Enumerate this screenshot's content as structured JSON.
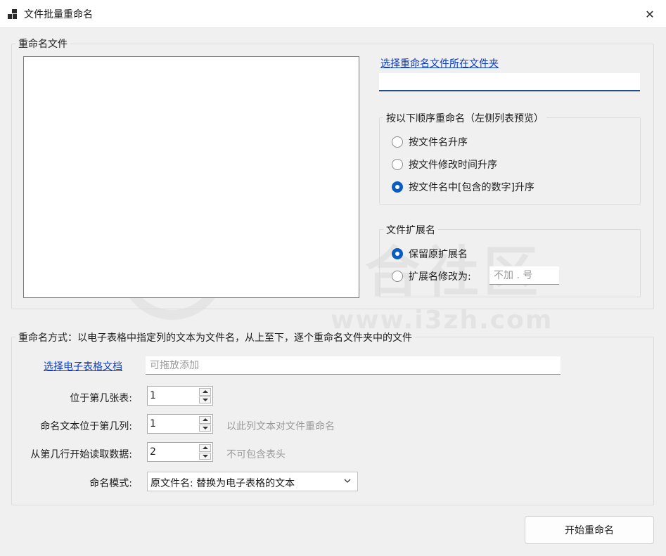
{
  "window": {
    "title": "文件批量重命名",
    "icon": "app-icon",
    "close_glyph": "✕"
  },
  "files_group": {
    "label": "重命名文件",
    "select_folder_link": "选择重命名文件所在文件夹",
    "folder_path_value": ""
  },
  "order_group": {
    "label": "按以下顺序重命名（左侧列表预览）",
    "options": [
      {
        "label": "按文件名升序",
        "checked": false
      },
      {
        "label": "按文件修改时间升序",
        "checked": false
      },
      {
        "label": "按文件名中[包含的数字]升序",
        "checked": true
      }
    ]
  },
  "ext_group": {
    "label": "文件扩展名",
    "keep_label": "保留原扩展名",
    "keep_checked": true,
    "change_label": "扩展名修改为:",
    "change_checked": false,
    "change_placeholder": "不加 . 号"
  },
  "sheet_group": {
    "label": "重命名方式：以电子表格中指定列的文本为文件名，从上至下，逐个重命名文件夹中的文件",
    "select_sheet_link": "选择电子表格文档",
    "sheet_path_placeholder": "可拖放添加",
    "sheet_index_label": "位于第几张表:",
    "sheet_index_value": "1",
    "column_label": "命名文本位于第几列:",
    "column_value": "1",
    "column_hint": "以此列文本对文件重命名",
    "start_row_label": "从第几行开始读取数据:",
    "start_row_value": "2",
    "start_row_hint": "不可包含表头",
    "mode_label": "命名模式:",
    "mode_value": "原文件名: 替换为电子表格的文本"
  },
  "actions": {
    "start_label": "开始重命名"
  },
  "colors": {
    "link": "#0b3bc4",
    "accent": "#0a5cc2",
    "background": "#f0f0f0"
  }
}
